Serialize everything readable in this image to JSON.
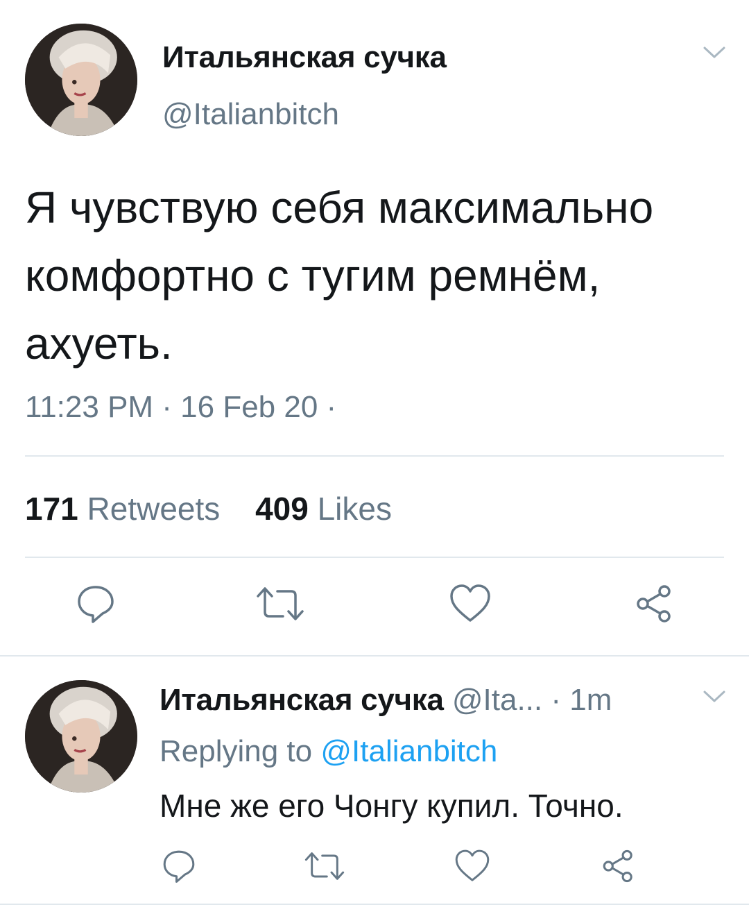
{
  "tweet": {
    "avatar_icon": "profile-photo",
    "display_name": "Итальянская сучка",
    "handle": "@Italianbitch",
    "text": "Я чувствую себя максимально комфортно с тугим ремнём, ахуеть.",
    "timestamp": "11:23 PM · 16 Feb 20 ·",
    "stats": {
      "retweets_count": "171",
      "retweets_label": "Retweets",
      "likes_count": "409",
      "likes_label": "Likes"
    },
    "actions": [
      "reply-icon",
      "retweet-icon",
      "like-icon",
      "share-icon"
    ]
  },
  "reply": {
    "avatar_icon": "profile-photo",
    "display_name": "Итальянская сучка",
    "handle": "@Ita...",
    "time": "· 1m",
    "replying_prefix": "Replying to",
    "replying_handle": "@Italianbitch",
    "text": "Мне же его Чонгу купил. Точно.",
    "actions": [
      "reply-icon",
      "retweet-icon",
      "like-icon",
      "share-icon"
    ]
  },
  "colors": {
    "text_primary": "#14171a",
    "text_secondary": "#657786",
    "link": "#1da1f2",
    "divider": "#e1e8ed"
  }
}
